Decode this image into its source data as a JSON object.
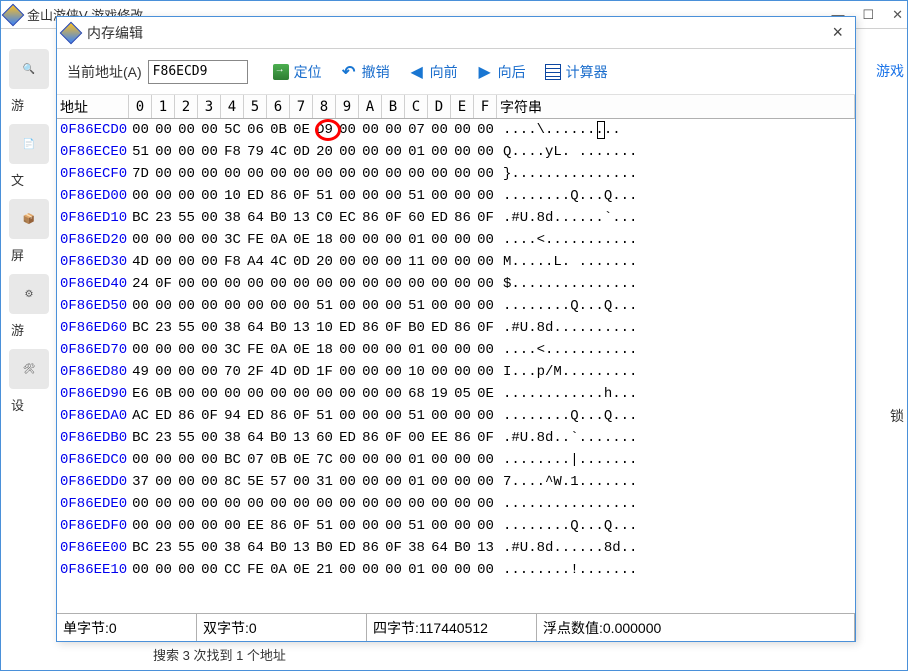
{
  "bg": {
    "title": "金山游侠V    游戏修改",
    "sidebar": {
      "item2_label": "文",
      "item4_label": "屏",
      "item6_label": "游",
      "item7_label": "设"
    },
    "right_link": "游戏",
    "right_label2": "锁",
    "bottom_status": "搜索 3 次找到 1 个地址"
  },
  "memwin": {
    "title": "内存编辑",
    "addr_label": "当前地址(A)",
    "addr_value": "F86ECD9",
    "toolbar": {
      "locate": "定位",
      "undo": "撤销",
      "back": "向前",
      "forward": "向后",
      "calc": "计算器"
    },
    "headers": {
      "addr": "地址",
      "bytes": [
        "0",
        "1",
        "2",
        "3",
        "4",
        "5",
        "6",
        "7",
        "8",
        "9",
        "A",
        "B",
        "C",
        "D",
        "E",
        "F"
      ],
      "ascii": "字符串"
    },
    "rows": [
      {
        "addr": "0F86ECD0",
        "bytes": [
          "00",
          "00",
          "00",
          "00",
          "5C",
          "06",
          "0B",
          "0E",
          "D9",
          "00",
          "00",
          "00",
          "07",
          "00",
          "00",
          "00"
        ],
        "ascii": "....\\........."
      },
      {
        "addr": "0F86ECE0",
        "bytes": [
          "51",
          "00",
          "00",
          "00",
          "F8",
          "79",
          "4C",
          "0D",
          "20",
          "00",
          "00",
          "00",
          "01",
          "00",
          "00",
          "00"
        ],
        "ascii": "Q....yL. ......."
      },
      {
        "addr": "0F86ECF0",
        "bytes": [
          "7D",
          "00",
          "00",
          "00",
          "00",
          "00",
          "00",
          "00",
          "00",
          "00",
          "00",
          "00",
          "00",
          "00",
          "00",
          "00"
        ],
        "ascii": "}..............."
      },
      {
        "addr": "0F86ED00",
        "bytes": [
          "00",
          "00",
          "00",
          "00",
          "10",
          "ED",
          "86",
          "0F",
          "51",
          "00",
          "00",
          "00",
          "51",
          "00",
          "00",
          "00"
        ],
        "ascii": "........Q...Q..."
      },
      {
        "addr": "0F86ED10",
        "bytes": [
          "BC",
          "23",
          "55",
          "00",
          "38",
          "64",
          "B0",
          "13",
          "C0",
          "EC",
          "86",
          "0F",
          "60",
          "ED",
          "86",
          "0F"
        ],
        "ascii": ".#U.8d......`..."
      },
      {
        "addr": "0F86ED20",
        "bytes": [
          "00",
          "00",
          "00",
          "00",
          "3C",
          "FE",
          "0A",
          "0E",
          "18",
          "00",
          "00",
          "00",
          "01",
          "00",
          "00",
          "00"
        ],
        "ascii": "....<..........."
      },
      {
        "addr": "0F86ED30",
        "bytes": [
          "4D",
          "00",
          "00",
          "00",
          "F8",
          "A4",
          "4C",
          "0D",
          "20",
          "00",
          "00",
          "00",
          "11",
          "00",
          "00",
          "00"
        ],
        "ascii": "M.....L. ......."
      },
      {
        "addr": "0F86ED40",
        "bytes": [
          "24",
          "0F",
          "00",
          "00",
          "00",
          "00",
          "00",
          "00",
          "00",
          "00",
          "00",
          "00",
          "00",
          "00",
          "00",
          "00"
        ],
        "ascii": "$..............."
      },
      {
        "addr": "0F86ED50",
        "bytes": [
          "00",
          "00",
          "00",
          "00",
          "00",
          "00",
          "00",
          "00",
          "51",
          "00",
          "00",
          "00",
          "51",
          "00",
          "00",
          "00"
        ],
        "ascii": "........Q...Q..."
      },
      {
        "addr": "0F86ED60",
        "bytes": [
          "BC",
          "23",
          "55",
          "00",
          "38",
          "64",
          "B0",
          "13",
          "10",
          "ED",
          "86",
          "0F",
          "B0",
          "ED",
          "86",
          "0F"
        ],
        "ascii": ".#U.8d.........."
      },
      {
        "addr": "0F86ED70",
        "bytes": [
          "00",
          "00",
          "00",
          "00",
          "3C",
          "FE",
          "0A",
          "0E",
          "18",
          "00",
          "00",
          "00",
          "01",
          "00",
          "00",
          "00"
        ],
        "ascii": "....<..........."
      },
      {
        "addr": "0F86ED80",
        "bytes": [
          "49",
          "00",
          "00",
          "00",
          "70",
          "2F",
          "4D",
          "0D",
          "1F",
          "00",
          "00",
          "00",
          "10",
          "00",
          "00",
          "00"
        ],
        "ascii": "I...p/M........."
      },
      {
        "addr": "0F86ED90",
        "bytes": [
          "E6",
          "0B",
          "00",
          "00",
          "00",
          "00",
          "00",
          "00",
          "00",
          "00",
          "00",
          "00",
          "68",
          "19",
          "05",
          "0E"
        ],
        "ascii": "............h..."
      },
      {
        "addr": "0F86EDA0",
        "bytes": [
          "AC",
          "ED",
          "86",
          "0F",
          "94",
          "ED",
          "86",
          "0F",
          "51",
          "00",
          "00",
          "00",
          "51",
          "00",
          "00",
          "00"
        ],
        "ascii": "........Q...Q..."
      },
      {
        "addr": "0F86EDB0",
        "bytes": [
          "BC",
          "23",
          "55",
          "00",
          "38",
          "64",
          "B0",
          "13",
          "60",
          "ED",
          "86",
          "0F",
          "00",
          "EE",
          "86",
          "0F"
        ],
        "ascii": ".#U.8d..`......."
      },
      {
        "addr": "0F86EDC0",
        "bytes": [
          "00",
          "00",
          "00",
          "00",
          "BC",
          "07",
          "0B",
          "0E",
          "7C",
          "00",
          "00",
          "00",
          "01",
          "00",
          "00",
          "00"
        ],
        "ascii": "........|......."
      },
      {
        "addr": "0F86EDD0",
        "bytes": [
          "37",
          "00",
          "00",
          "00",
          "8C",
          "5E",
          "57",
          "00",
          "31",
          "00",
          "00",
          "00",
          "01",
          "00",
          "00",
          "00"
        ],
        "ascii": "7....^W.1......."
      },
      {
        "addr": "0F86EDE0",
        "bytes": [
          "00",
          "00",
          "00",
          "00",
          "00",
          "00",
          "00",
          "00",
          "00",
          "00",
          "00",
          "00",
          "00",
          "00",
          "00",
          "00"
        ],
        "ascii": "................"
      },
      {
        "addr": "0F86EDF0",
        "bytes": [
          "00",
          "00",
          "00",
          "00",
          "00",
          "EE",
          "86",
          "0F",
          "51",
          "00",
          "00",
          "00",
          "51",
          "00",
          "00",
          "00"
        ],
        "ascii": "........Q...Q..."
      },
      {
        "addr": "0F86EE00",
        "bytes": [
          "BC",
          "23",
          "55",
          "00",
          "38",
          "64",
          "B0",
          "13",
          "B0",
          "ED",
          "86",
          "0F",
          "38",
          "64",
          "B0",
          "13"
        ],
        "ascii": ".#U.8d......8d.."
      },
      {
        "addr": "0F86EE10",
        "bytes": [
          "00",
          "00",
          "00",
          "00",
          "CC",
          "FE",
          "0A",
          "0E",
          "21",
          "00",
          "00",
          "00",
          "01",
          "00",
          "00",
          "00"
        ],
        "ascii": "........!......."
      }
    ],
    "status": {
      "byte": "单字节:0",
      "dword": "双字节:0",
      "qword": "四字节:117440512",
      "float": "浮点数值:0.000000"
    }
  }
}
